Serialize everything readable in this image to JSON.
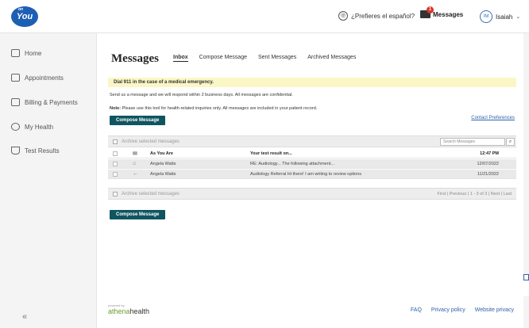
{
  "header": {
    "logo_small": "on",
    "logo_text": "You",
    "language_link": "¿Prefieres el español?",
    "messages_label": "Messages",
    "messages_badge": "1",
    "user_initials": "IM",
    "user_name": "Isaiah"
  },
  "sidebar": {
    "items": [
      {
        "label": "Home",
        "icon": "home-icon"
      },
      {
        "label": "Appointments",
        "icon": "calendar-icon"
      },
      {
        "label": "Billing & Payments",
        "icon": "billing-icon"
      },
      {
        "label": "My Health",
        "icon": "heart-icon"
      },
      {
        "label": "Test Results",
        "icon": "flask-icon"
      }
    ],
    "collapse_label": "«"
  },
  "main": {
    "title": "Messages",
    "tabs": [
      "Inbox",
      "Compose Message",
      "Sent Messages",
      "Archived Messages"
    ],
    "active_tab": "Inbox",
    "alert": "Dial 911 in the case of a medical emergency.",
    "info1": "Send us a message and we will respond within 2 business days. All messages are confidential.",
    "info2_bold": "Note:",
    "info2": " Please use this tool for health-related inquiries only. All messages are included in your patient record.",
    "compose_button": "Compose Message",
    "contact_preferences": "Contact Preferences",
    "archive_label": "Archive selected messages",
    "search_placeholder": "Search Messages",
    "pager": "First | Previous | 1 - 3 of 3 | Next | Last",
    "rows": [
      {
        "from": "As You Are",
        "subject": "Your test result on...",
        "date": "12:47 PM",
        "unread": true
      },
      {
        "from": "Angela Watts",
        "subject": "RE: Audiology... The following attachment...",
        "date": "12/07/2022",
        "unread": false
      },
      {
        "from": "Angela Watts",
        "subject": "Audiology Referral  Hi there! I am writing to review options",
        "date": "11/21/2022",
        "unread": false
      }
    ]
  },
  "footer": {
    "powered_by": "powered by",
    "brand_a": "athena",
    "brand_b": "health",
    "links": [
      "FAQ",
      "Privacy policy",
      "Website privacy"
    ]
  },
  "colors": {
    "primary_button": "#0f5560",
    "alert_bg": "#fbf6c5",
    "link": "#2d63a8"
  }
}
